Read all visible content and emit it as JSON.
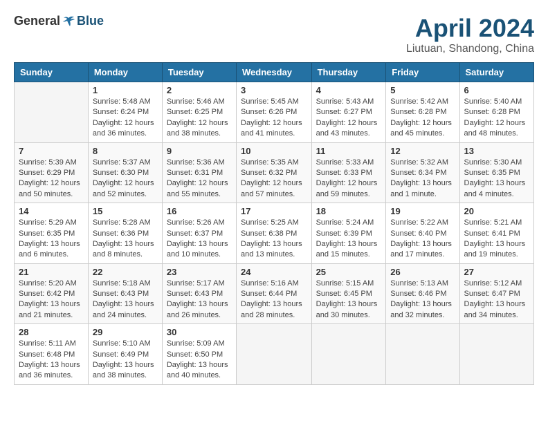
{
  "header": {
    "logo": {
      "general": "General",
      "blue": "Blue"
    },
    "title": "April 2024",
    "location": "Liutuan, Shandong, China"
  },
  "weekdays": [
    "Sunday",
    "Monday",
    "Tuesday",
    "Wednesday",
    "Thursday",
    "Friday",
    "Saturday"
  ],
  "weeks": [
    [
      {
        "day": "",
        "info": ""
      },
      {
        "day": "1",
        "info": "Sunrise: 5:48 AM\nSunset: 6:24 PM\nDaylight: 12 hours\nand 36 minutes."
      },
      {
        "day": "2",
        "info": "Sunrise: 5:46 AM\nSunset: 6:25 PM\nDaylight: 12 hours\nand 38 minutes."
      },
      {
        "day": "3",
        "info": "Sunrise: 5:45 AM\nSunset: 6:26 PM\nDaylight: 12 hours\nand 41 minutes."
      },
      {
        "day": "4",
        "info": "Sunrise: 5:43 AM\nSunset: 6:27 PM\nDaylight: 12 hours\nand 43 minutes."
      },
      {
        "day": "5",
        "info": "Sunrise: 5:42 AM\nSunset: 6:28 PM\nDaylight: 12 hours\nand 45 minutes."
      },
      {
        "day": "6",
        "info": "Sunrise: 5:40 AM\nSunset: 6:28 PM\nDaylight: 12 hours\nand 48 minutes."
      }
    ],
    [
      {
        "day": "7",
        "info": "Sunrise: 5:39 AM\nSunset: 6:29 PM\nDaylight: 12 hours\nand 50 minutes."
      },
      {
        "day": "8",
        "info": "Sunrise: 5:37 AM\nSunset: 6:30 PM\nDaylight: 12 hours\nand 52 minutes."
      },
      {
        "day": "9",
        "info": "Sunrise: 5:36 AM\nSunset: 6:31 PM\nDaylight: 12 hours\nand 55 minutes."
      },
      {
        "day": "10",
        "info": "Sunrise: 5:35 AM\nSunset: 6:32 PM\nDaylight: 12 hours\nand 57 minutes."
      },
      {
        "day": "11",
        "info": "Sunrise: 5:33 AM\nSunset: 6:33 PM\nDaylight: 12 hours\nand 59 minutes."
      },
      {
        "day": "12",
        "info": "Sunrise: 5:32 AM\nSunset: 6:34 PM\nDaylight: 13 hours\nand 1 minute."
      },
      {
        "day": "13",
        "info": "Sunrise: 5:30 AM\nSunset: 6:35 PM\nDaylight: 13 hours\nand 4 minutes."
      }
    ],
    [
      {
        "day": "14",
        "info": "Sunrise: 5:29 AM\nSunset: 6:35 PM\nDaylight: 13 hours\nand 6 minutes."
      },
      {
        "day": "15",
        "info": "Sunrise: 5:28 AM\nSunset: 6:36 PM\nDaylight: 13 hours\nand 8 minutes."
      },
      {
        "day": "16",
        "info": "Sunrise: 5:26 AM\nSunset: 6:37 PM\nDaylight: 13 hours\nand 10 minutes."
      },
      {
        "day": "17",
        "info": "Sunrise: 5:25 AM\nSunset: 6:38 PM\nDaylight: 13 hours\nand 13 minutes."
      },
      {
        "day": "18",
        "info": "Sunrise: 5:24 AM\nSunset: 6:39 PM\nDaylight: 13 hours\nand 15 minutes."
      },
      {
        "day": "19",
        "info": "Sunrise: 5:22 AM\nSunset: 6:40 PM\nDaylight: 13 hours\nand 17 minutes."
      },
      {
        "day": "20",
        "info": "Sunrise: 5:21 AM\nSunset: 6:41 PM\nDaylight: 13 hours\nand 19 minutes."
      }
    ],
    [
      {
        "day": "21",
        "info": "Sunrise: 5:20 AM\nSunset: 6:42 PM\nDaylight: 13 hours\nand 21 minutes."
      },
      {
        "day": "22",
        "info": "Sunrise: 5:18 AM\nSunset: 6:43 PM\nDaylight: 13 hours\nand 24 minutes."
      },
      {
        "day": "23",
        "info": "Sunrise: 5:17 AM\nSunset: 6:43 PM\nDaylight: 13 hours\nand 26 minutes."
      },
      {
        "day": "24",
        "info": "Sunrise: 5:16 AM\nSunset: 6:44 PM\nDaylight: 13 hours\nand 28 minutes."
      },
      {
        "day": "25",
        "info": "Sunrise: 5:15 AM\nSunset: 6:45 PM\nDaylight: 13 hours\nand 30 minutes."
      },
      {
        "day": "26",
        "info": "Sunrise: 5:13 AM\nSunset: 6:46 PM\nDaylight: 13 hours\nand 32 minutes."
      },
      {
        "day": "27",
        "info": "Sunrise: 5:12 AM\nSunset: 6:47 PM\nDaylight: 13 hours\nand 34 minutes."
      }
    ],
    [
      {
        "day": "28",
        "info": "Sunrise: 5:11 AM\nSunset: 6:48 PM\nDaylight: 13 hours\nand 36 minutes."
      },
      {
        "day": "29",
        "info": "Sunrise: 5:10 AM\nSunset: 6:49 PM\nDaylight: 13 hours\nand 38 minutes."
      },
      {
        "day": "30",
        "info": "Sunrise: 5:09 AM\nSunset: 6:50 PM\nDaylight: 13 hours\nand 40 minutes."
      },
      {
        "day": "",
        "info": ""
      },
      {
        "day": "",
        "info": ""
      },
      {
        "day": "",
        "info": ""
      },
      {
        "day": "",
        "info": ""
      }
    ]
  ]
}
